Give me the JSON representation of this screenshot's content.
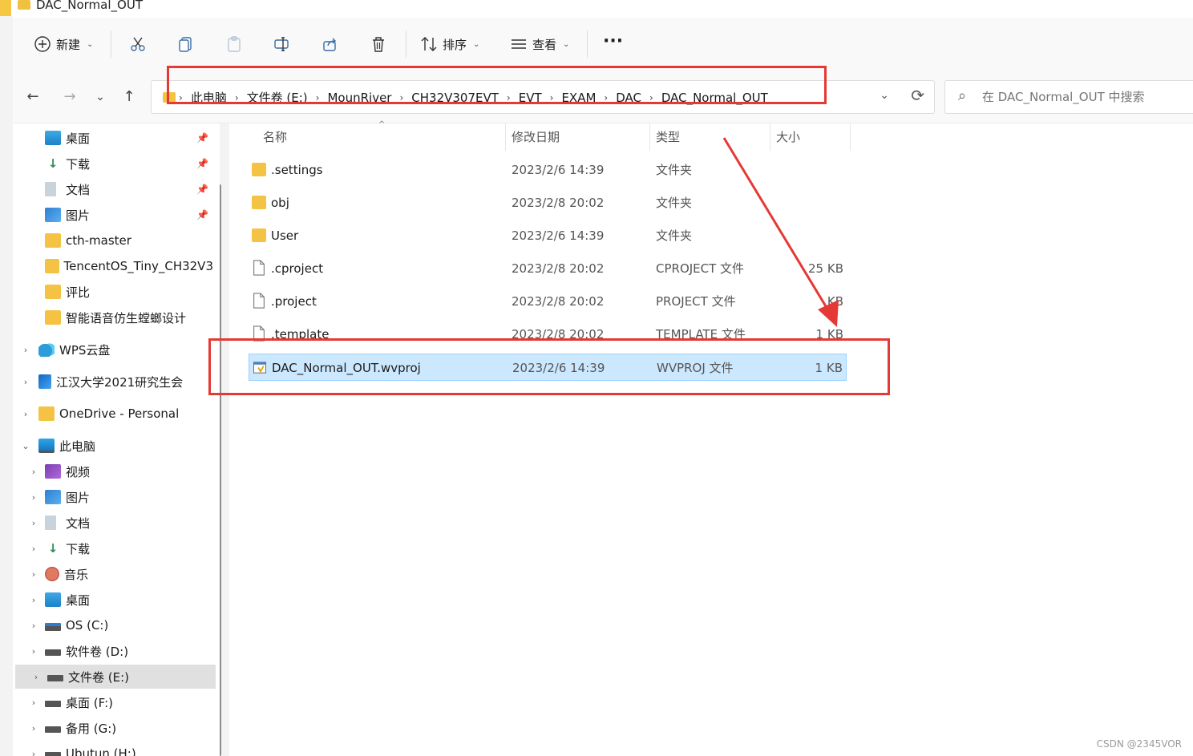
{
  "window": {
    "title": "DAC_Normal_OUT"
  },
  "toolbar": {
    "new_label": "新建",
    "cut_icon": "scissors-icon",
    "copy_icon": "copy-icon",
    "paste_icon": "paste-icon",
    "rename_icon": "rename-icon",
    "share_icon": "share-icon",
    "delete_icon": "trash-icon",
    "sort_label": "排序",
    "view_label": "查看",
    "more_label": "···"
  },
  "nav": {
    "back": "←",
    "forward": "→",
    "recent": "⌄",
    "up": "↑"
  },
  "address": {
    "crumbs": [
      "此电脑",
      "文件卷 (E:)",
      "MounRiver",
      "CH32V307EVT",
      "EVT",
      "EXAM",
      "DAC",
      "DAC_Normal_OUT"
    ],
    "sep": "›"
  },
  "search": {
    "placeholder": "在 DAC_Normal_OUT 中搜索"
  },
  "sidebar": {
    "quick": [
      {
        "label": "桌面",
        "icon": "desktop-icon",
        "pinned": true
      },
      {
        "label": "下载",
        "icon": "download-icon",
        "pinned": true
      },
      {
        "label": "文档",
        "icon": "document-icon",
        "pinned": true
      },
      {
        "label": "图片",
        "icon": "pictures-icon",
        "pinned": true
      },
      {
        "label": "cth-master",
        "icon": "folder-icon",
        "pinned": false
      },
      {
        "label": "TencentOS_Tiny_CH32V3",
        "icon": "folder-icon",
        "pinned": false
      },
      {
        "label": "评比",
        "icon": "folder-icon",
        "pinned": false
      },
      {
        "label": "智能语音仿生螳螂设计",
        "icon": "folder-icon",
        "pinned": false
      }
    ],
    "groups": [
      {
        "label": "WPS云盘",
        "icon": "cloud-icon",
        "expander": "›"
      },
      {
        "label": "江汉大学2021研究生会",
        "icon": "cloud-drive-icon",
        "expander": "›"
      },
      {
        "label": "OneDrive - Personal",
        "icon": "folder-icon",
        "expander": "›"
      },
      {
        "label": "此电脑",
        "icon": "computer-icon",
        "expander": "⌄"
      }
    ],
    "thispc": [
      {
        "label": "视频",
        "icon": "videos-icon"
      },
      {
        "label": "图片",
        "icon": "pictures-icon"
      },
      {
        "label": "文档",
        "icon": "document-icon"
      },
      {
        "label": "下载",
        "icon": "download-icon"
      },
      {
        "label": "音乐",
        "icon": "music-icon"
      },
      {
        "label": "桌面",
        "icon": "desktop-icon"
      },
      {
        "label": "OS (C:)",
        "icon": "windows-drive-icon"
      },
      {
        "label": "软件卷 (D:)",
        "icon": "drive-icon"
      },
      {
        "label": "文件卷 (E:)",
        "icon": "drive-icon",
        "selected": true
      },
      {
        "label": "桌面 (F:)",
        "icon": "drive-icon"
      },
      {
        "label": "备用 (G:)",
        "icon": "drive-icon"
      },
      {
        "label": "Ubutun (H:)",
        "icon": "drive-icon"
      }
    ]
  },
  "columns": {
    "name": "名称",
    "date": "修改日期",
    "type": "类型",
    "size": "大小"
  },
  "files": [
    {
      "name": ".settings",
      "date": "2023/2/6 14:39",
      "type": "文件夹",
      "size": "",
      "icon": "folder-icon"
    },
    {
      "name": "obj",
      "date": "2023/2/8 20:02",
      "type": "文件夹",
      "size": "",
      "icon": "folder-icon"
    },
    {
      "name": "User",
      "date": "2023/2/6 14:39",
      "type": "文件夹",
      "size": "",
      "icon": "folder-icon"
    },
    {
      "name": ".cproject",
      "date": "2023/2/8 20:02",
      "type": "CPROJECT 文件",
      "size": "25 KB",
      "icon": "file-icon"
    },
    {
      "name": ".project",
      "date": "2023/2/8 20:02",
      "type": "PROJECT 文件",
      "size": "KB",
      "icon": "file-icon"
    },
    {
      "name": ".template",
      "date": "2023/2/8 20:02",
      "type": "TEMPLATE 文件",
      "size": "1 KB",
      "icon": "file-icon"
    },
    {
      "name": "DAC_Normal_OUT.wvproj",
      "date": "2023/2/6 14:39",
      "type": "WVPROJ 文件",
      "size": "1 KB",
      "icon": "wvproj-file-icon",
      "selected": true
    }
  ],
  "watermark": "CSDN @2345VOR",
  "colors": {
    "annotation": "#e53935",
    "selection": "#cce8ff",
    "folder": "#f4c343"
  }
}
